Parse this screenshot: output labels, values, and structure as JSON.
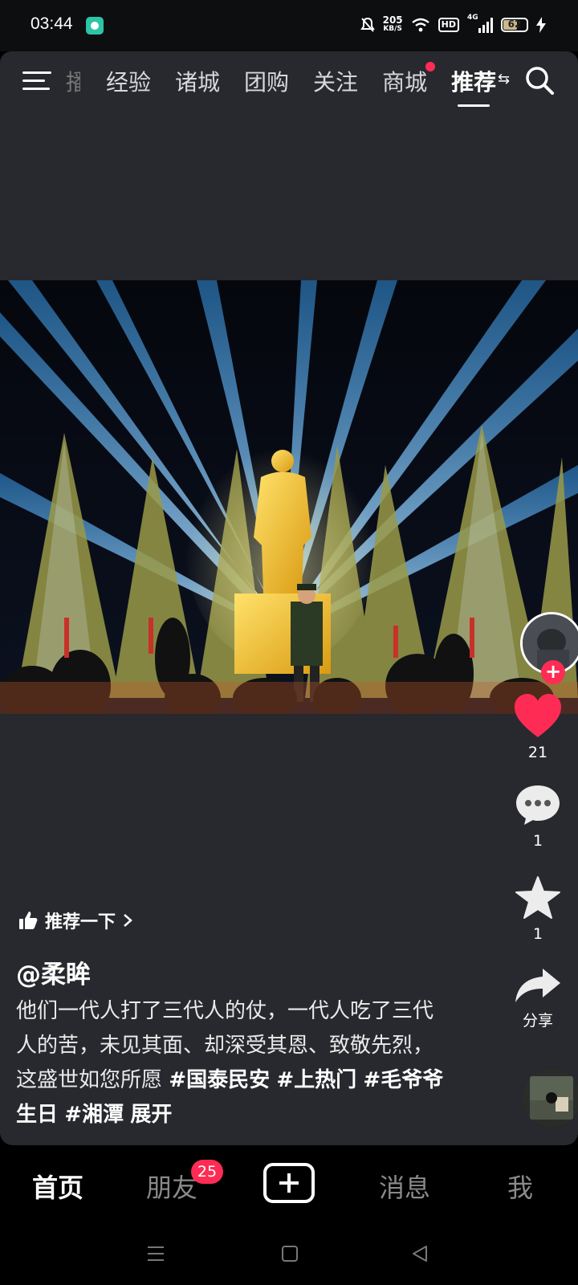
{
  "status_bar": {
    "time": "03:44",
    "net_speed_value": "205",
    "net_speed_unit": "KB/S",
    "hd_label": "HD",
    "network_label": "4G",
    "battery_level": "62",
    "battery_percent": 62
  },
  "top_nav": {
    "tabs": [
      {
        "label": "播",
        "faded": true
      },
      {
        "label": "经验"
      },
      {
        "label": "诸城"
      },
      {
        "label": "团购"
      },
      {
        "label": "关注"
      },
      {
        "label": "商城",
        "has_dot": true
      },
      {
        "label": "推荐",
        "active": true
      }
    ],
    "active_tab_switch_icon": "⇆"
  },
  "right_rail": {
    "like_count": "21",
    "comment_count": "1",
    "favorite_count": "1",
    "share_label": "分享"
  },
  "caption": {
    "recommend_label": "推荐一下",
    "username": "@柔眸",
    "text": "他们一代人打了三代人的仗，一代人吃了三代人的苦，未见其面、却深受其恩、致敬先烈，这盛世如您所愿",
    "hashtags": [
      "#国泰民安",
      "#上热门",
      "#毛爷爷生日",
      "#湘潭"
    ],
    "expand_label": "展开"
  },
  "bottom_bar": {
    "home": "首页",
    "friends": "朋友",
    "friends_badge": "25",
    "messages": "消息",
    "me": "我"
  },
  "colors": {
    "accent": "#fe2c55",
    "panel_bg": "#27292e",
    "like_red": "#fe2c55"
  }
}
